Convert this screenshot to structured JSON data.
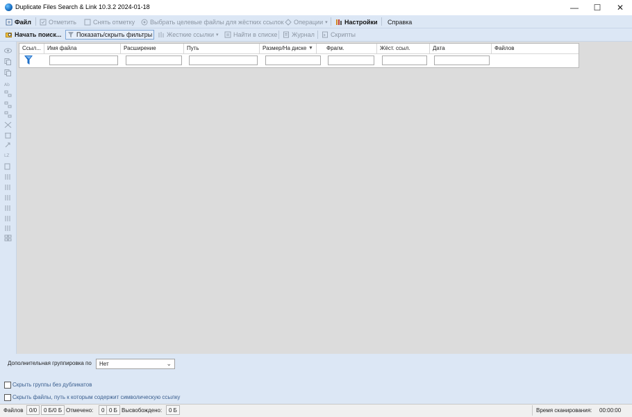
{
  "window": {
    "title": "Duplicate Files Search & Link 10.3.2 2024-01-18",
    "minimize": "—",
    "maximize": "☐",
    "close": "✕"
  },
  "menu": {
    "file": "Файл",
    "mark": "Отметить",
    "unmark": "Снять отметку",
    "select_hardlink_targets": "Выбрать целевые файлы для жёстких ссылок",
    "operations": "Операции",
    "settings": "Настройки",
    "help": "Справка"
  },
  "toolbar": {
    "start_search": "Начать поиск...",
    "toggle_filters": "Показать/скрыть фильтры",
    "hard_links": "Жесткие ссылки",
    "find_in_list": "Найти в списке",
    "journal": "Журнал",
    "scripts": "Скрипты"
  },
  "grid": {
    "columns": [
      "Ссыл...",
      "Имя файла",
      "Расширение",
      "Путь",
      "Размер/На диске",
      "Фрагм.",
      "Жёст. ссыл.",
      "Дата",
      "Файлов"
    ]
  },
  "bottom": {
    "grouping_label": "Дополнительная группировка по",
    "grouping_value": "Нет",
    "hide_groups_label": "Скрыть группы без дубликатов",
    "hide_symlinks_label": "Скрыть файлы, путь к которым содержит символическую ссылку"
  },
  "status": {
    "files_label": "Файлов",
    "files_value": "0/0",
    "size_value": "0 Б/0 Б",
    "marked_label": "Отмечено:",
    "marked_count": "0",
    "marked_size": "0 Б",
    "freed_label": "Высвобождено:",
    "freed_value": "0 Б",
    "scan_time_label": "Время сканирования:",
    "scan_time_value": "00:00:00"
  },
  "colors": {
    "accent_bg": "#dce7f5",
    "grid_bg": "#dcdcdc",
    "filter_icon": "#1e6fc8"
  }
}
